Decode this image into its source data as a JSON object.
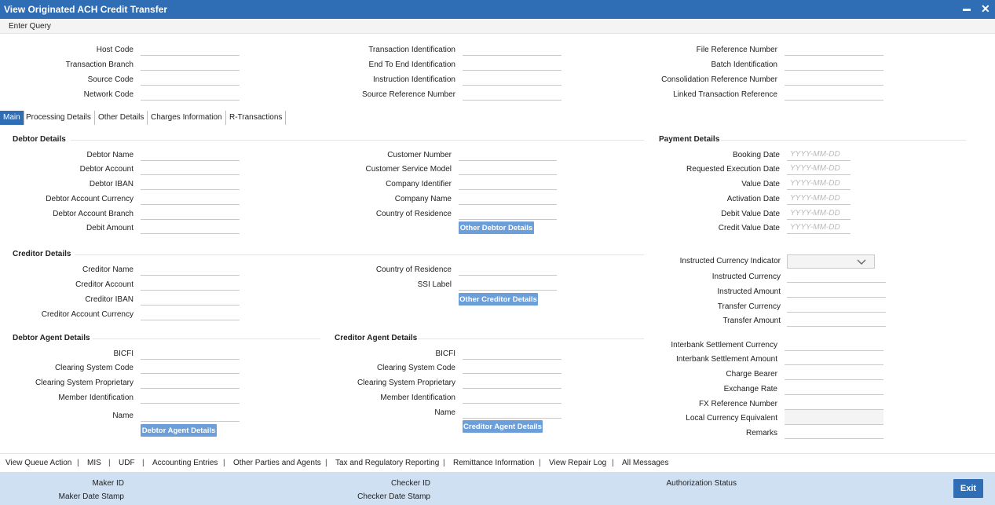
{
  "window": {
    "title": "View Originated ACH Credit Transfer",
    "minimize_glyph": "▬",
    "close_glyph": "✕"
  },
  "menu": {
    "enter_query": "Enter Query"
  },
  "header": {
    "col1": [
      "Host Code",
      "Transaction Branch",
      "Source Code",
      "Network Code"
    ],
    "col2": [
      "Transaction Identification",
      "End To End Identification",
      "Instruction Identification",
      "Source Reference Number"
    ],
    "col3": [
      "File Reference Number",
      "Batch Identification",
      "Consolidation Reference Number",
      "Linked Transaction Reference"
    ]
  },
  "tabs": [
    "Main",
    "Processing Details",
    "Other Details",
    "Charges Information",
    "R-Transactions"
  ],
  "debtor": {
    "title": "Debtor Details",
    "left": [
      "Debtor Name",
      "Debtor Account",
      "Debtor IBAN",
      "Debtor Account Currency",
      "Debtor Account Branch",
      "Debit Amount"
    ],
    "right": [
      "Customer Number",
      "Customer Service Model",
      "Company Identifier",
      "Company Name",
      "Country of Residence"
    ],
    "button": "Other Debtor Details"
  },
  "payment": {
    "title": "Payment Details",
    "dates": [
      "Booking Date",
      "Requested Execution Date",
      "Value Date",
      "Activation Date",
      "Debit Value Date",
      "Credit Value Date"
    ],
    "date_placeholder": "YYYY-MM-DD"
  },
  "creditor": {
    "title": "Creditor Details",
    "left": [
      "Creditor Name",
      "Creditor Account",
      "Creditor IBAN",
      "Creditor Account Currency"
    ],
    "right": [
      "Country of Residence",
      "SSI Label"
    ],
    "button": "Other Creditor Details"
  },
  "amounts": {
    "labels_a": [
      "Instructed Currency Indicator",
      "Instructed Currency",
      "Instructed Amount",
      "Transfer Currency",
      "Transfer Amount"
    ],
    "labels_b": [
      "Interbank Settlement Currency",
      "Interbank Settlement Amount",
      "Charge Bearer",
      "Exchange Rate",
      "FX Reference Number",
      "Local Currency Equivalent",
      "Remarks"
    ]
  },
  "debtor_agent": {
    "title": "Debtor Agent Details",
    "labels": [
      "BICFI",
      "Clearing System Code",
      "Clearing System Proprietary",
      "Member Identification",
      "Name"
    ],
    "button": "Debtor Agent Details"
  },
  "creditor_agent": {
    "title": "Creditor Agent Details",
    "labels": [
      "BICFI",
      "Clearing System Code",
      "Clearing System Proprietary",
      "Member Identification",
      "Name"
    ],
    "button": "Creditor Agent Details"
  },
  "links": [
    "View Queue Action",
    "MIS",
    "UDF",
    "Accounting Entries",
    "Other Parties and Agents",
    "Tax and Regulatory Reporting",
    "Remittance Information",
    "View Repair Log",
    "All Messages"
  ],
  "link_separator": "|",
  "footer": {
    "maker_id": "Maker ID",
    "maker_date": "Maker Date Stamp",
    "checker_id": "Checker ID",
    "checker_date": "Checker Date Stamp",
    "auth_status": "Authorization Status",
    "exit": "Exit"
  }
}
